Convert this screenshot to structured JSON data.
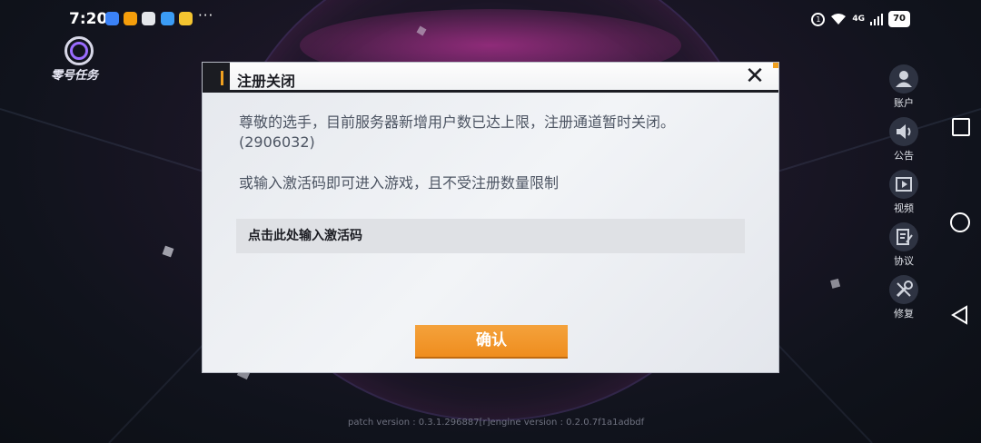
{
  "status_bar": {
    "time": "7:20",
    "more": "···",
    "network": "4G",
    "battery": "70",
    "notification_colors": [
      "#3b82f6",
      "#f59e0b",
      "#e5e7eb",
      "#3b9cf5",
      "#f4c430"
    ]
  },
  "game": {
    "logo_text": "零号任务",
    "version": "patch version : 0.3.1.296887[r]engine version : 0.2.0.7f1a1adbdf"
  },
  "side_menu": [
    {
      "label": "账户",
      "icon": "account-icon"
    },
    {
      "label": "公告",
      "icon": "announcement-icon"
    },
    {
      "label": "视频",
      "icon": "video-icon"
    },
    {
      "label": "协议",
      "icon": "agreement-icon"
    },
    {
      "label": "修复",
      "icon": "repair-icon"
    }
  ],
  "dialog": {
    "title": "注册关闭",
    "message_line1": "尊敬的选手，目前服务器新增用户数已达上限，注册通道暂时关闭。",
    "message_line2": "(2906032)",
    "message_line3": "或输入激活码即可进入游戏，且不受注册数量限制",
    "input_placeholder": "点击此处输入激活码",
    "confirm_label": "确认",
    "close_glyph": "✕",
    "accent_color": "#ef8d1e"
  }
}
